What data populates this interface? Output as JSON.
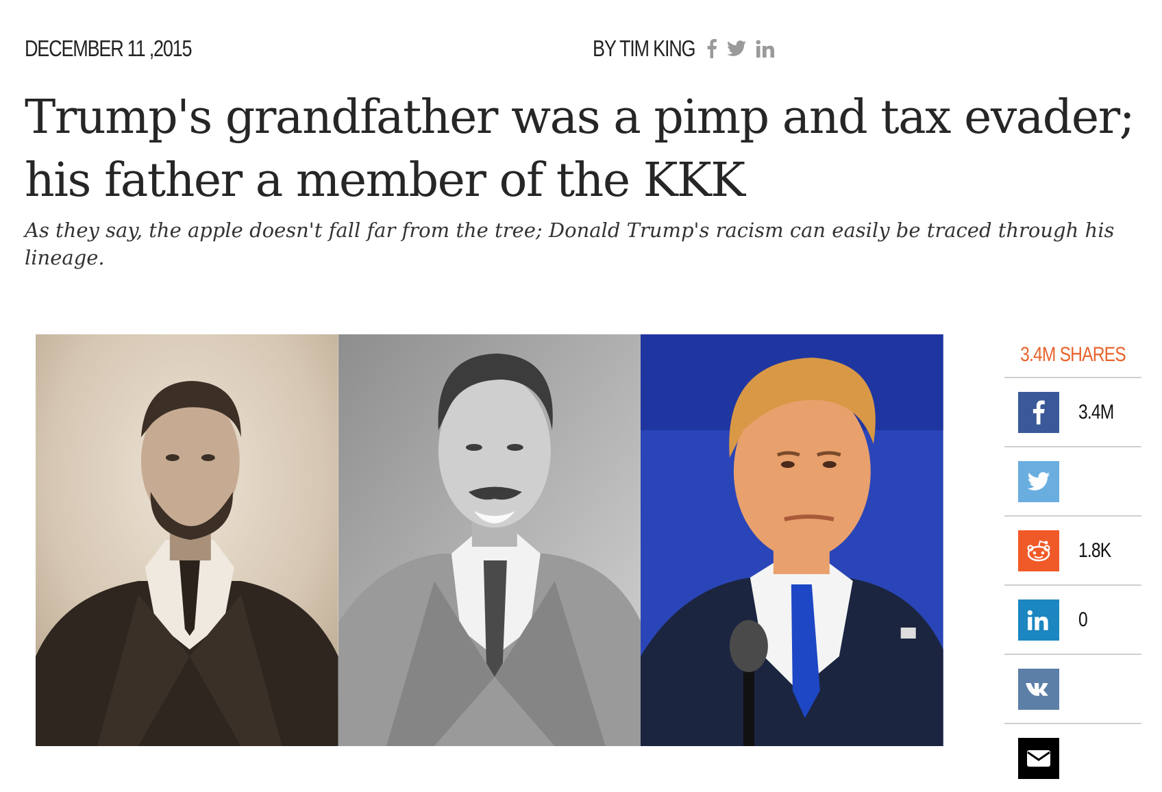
{
  "article": {
    "date": "DECEMBER 11 ,2015",
    "byline": "BY TIM KING",
    "author_social": [
      "facebook-icon",
      "twitter-icon",
      "linkedin-icon"
    ],
    "headline": "Trump's grandfather was a pimp and tax evader; his father a member of the KKK",
    "subtitle": "As they say, the apple doesn't fall far from the tree; Donald Trump's racism can easily be traced through his lineage."
  },
  "share_bar": {
    "total_label": "3.4M SHARES",
    "accent_color": "#e8632c",
    "buttons": [
      {
        "network": "facebook",
        "icon": "facebook-icon",
        "count": "3.4M",
        "color": "#3b5998"
      },
      {
        "network": "twitter",
        "icon": "twitter-icon",
        "count": "",
        "color": "#6aaee0"
      },
      {
        "network": "reddit",
        "icon": "reddit-icon",
        "count": "1.8K",
        "color": "#f05a28"
      },
      {
        "network": "linkedin",
        "icon": "linkedin-icon",
        "count": "0",
        "color": "#1b86c0"
      },
      {
        "network": "vk",
        "icon": "vk-icon",
        "count": "",
        "color": "#5b7fa6"
      },
      {
        "network": "email",
        "icon": "email-icon",
        "count": "",
        "color": "#000000"
      }
    ]
  },
  "hero_image": {
    "panels": [
      "sepia-portrait",
      "grayscale-portrait",
      "color-portrait"
    ]
  }
}
